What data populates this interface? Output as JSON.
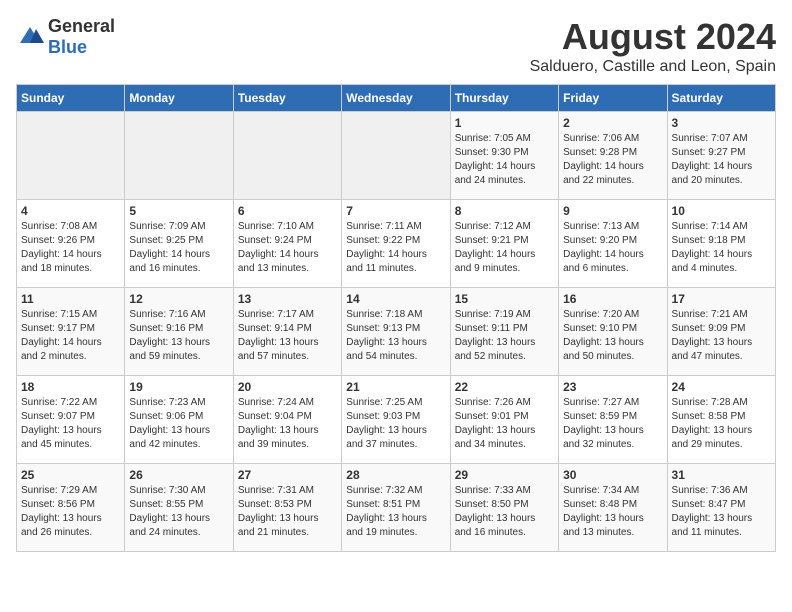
{
  "logo": {
    "general": "General",
    "blue": "Blue"
  },
  "title": "August 2024",
  "subtitle": "Salduero, Castille and Leon, Spain",
  "headers": [
    "Sunday",
    "Monday",
    "Tuesday",
    "Wednesday",
    "Thursday",
    "Friday",
    "Saturday"
  ],
  "weeks": [
    [
      {
        "day": "",
        "info": ""
      },
      {
        "day": "",
        "info": ""
      },
      {
        "day": "",
        "info": ""
      },
      {
        "day": "",
        "info": ""
      },
      {
        "day": "1",
        "info": "Sunrise: 7:05 AM\nSunset: 9:30 PM\nDaylight: 14 hours\nand 24 minutes."
      },
      {
        "day": "2",
        "info": "Sunrise: 7:06 AM\nSunset: 9:28 PM\nDaylight: 14 hours\nand 22 minutes."
      },
      {
        "day": "3",
        "info": "Sunrise: 7:07 AM\nSunset: 9:27 PM\nDaylight: 14 hours\nand 20 minutes."
      }
    ],
    [
      {
        "day": "4",
        "info": "Sunrise: 7:08 AM\nSunset: 9:26 PM\nDaylight: 14 hours\nand 18 minutes."
      },
      {
        "day": "5",
        "info": "Sunrise: 7:09 AM\nSunset: 9:25 PM\nDaylight: 14 hours\nand 16 minutes."
      },
      {
        "day": "6",
        "info": "Sunrise: 7:10 AM\nSunset: 9:24 PM\nDaylight: 14 hours\nand 13 minutes."
      },
      {
        "day": "7",
        "info": "Sunrise: 7:11 AM\nSunset: 9:22 PM\nDaylight: 14 hours\nand 11 minutes."
      },
      {
        "day": "8",
        "info": "Sunrise: 7:12 AM\nSunset: 9:21 PM\nDaylight: 14 hours\nand 9 minutes."
      },
      {
        "day": "9",
        "info": "Sunrise: 7:13 AM\nSunset: 9:20 PM\nDaylight: 14 hours\nand 6 minutes."
      },
      {
        "day": "10",
        "info": "Sunrise: 7:14 AM\nSunset: 9:18 PM\nDaylight: 14 hours\nand 4 minutes."
      }
    ],
    [
      {
        "day": "11",
        "info": "Sunrise: 7:15 AM\nSunset: 9:17 PM\nDaylight: 14 hours\nand 2 minutes."
      },
      {
        "day": "12",
        "info": "Sunrise: 7:16 AM\nSunset: 9:16 PM\nDaylight: 13 hours\nand 59 minutes."
      },
      {
        "day": "13",
        "info": "Sunrise: 7:17 AM\nSunset: 9:14 PM\nDaylight: 13 hours\nand 57 minutes."
      },
      {
        "day": "14",
        "info": "Sunrise: 7:18 AM\nSunset: 9:13 PM\nDaylight: 13 hours\nand 54 minutes."
      },
      {
        "day": "15",
        "info": "Sunrise: 7:19 AM\nSunset: 9:11 PM\nDaylight: 13 hours\nand 52 minutes."
      },
      {
        "day": "16",
        "info": "Sunrise: 7:20 AM\nSunset: 9:10 PM\nDaylight: 13 hours\nand 50 minutes."
      },
      {
        "day": "17",
        "info": "Sunrise: 7:21 AM\nSunset: 9:09 PM\nDaylight: 13 hours\nand 47 minutes."
      }
    ],
    [
      {
        "day": "18",
        "info": "Sunrise: 7:22 AM\nSunset: 9:07 PM\nDaylight: 13 hours\nand 45 minutes."
      },
      {
        "day": "19",
        "info": "Sunrise: 7:23 AM\nSunset: 9:06 PM\nDaylight: 13 hours\nand 42 minutes."
      },
      {
        "day": "20",
        "info": "Sunrise: 7:24 AM\nSunset: 9:04 PM\nDaylight: 13 hours\nand 39 minutes."
      },
      {
        "day": "21",
        "info": "Sunrise: 7:25 AM\nSunset: 9:03 PM\nDaylight: 13 hours\nand 37 minutes."
      },
      {
        "day": "22",
        "info": "Sunrise: 7:26 AM\nSunset: 9:01 PM\nDaylight: 13 hours\nand 34 minutes."
      },
      {
        "day": "23",
        "info": "Sunrise: 7:27 AM\nSunset: 8:59 PM\nDaylight: 13 hours\nand 32 minutes."
      },
      {
        "day": "24",
        "info": "Sunrise: 7:28 AM\nSunset: 8:58 PM\nDaylight: 13 hours\nand 29 minutes."
      }
    ],
    [
      {
        "day": "25",
        "info": "Sunrise: 7:29 AM\nSunset: 8:56 PM\nDaylight: 13 hours\nand 26 minutes."
      },
      {
        "day": "26",
        "info": "Sunrise: 7:30 AM\nSunset: 8:55 PM\nDaylight: 13 hours\nand 24 minutes."
      },
      {
        "day": "27",
        "info": "Sunrise: 7:31 AM\nSunset: 8:53 PM\nDaylight: 13 hours\nand 21 minutes."
      },
      {
        "day": "28",
        "info": "Sunrise: 7:32 AM\nSunset: 8:51 PM\nDaylight: 13 hours\nand 19 minutes."
      },
      {
        "day": "29",
        "info": "Sunrise: 7:33 AM\nSunset: 8:50 PM\nDaylight: 13 hours\nand 16 minutes."
      },
      {
        "day": "30",
        "info": "Sunrise: 7:34 AM\nSunset: 8:48 PM\nDaylight: 13 hours\nand 13 minutes."
      },
      {
        "day": "31",
        "info": "Sunrise: 7:36 AM\nSunset: 8:47 PM\nDaylight: 13 hours\nand 11 minutes."
      }
    ]
  ]
}
